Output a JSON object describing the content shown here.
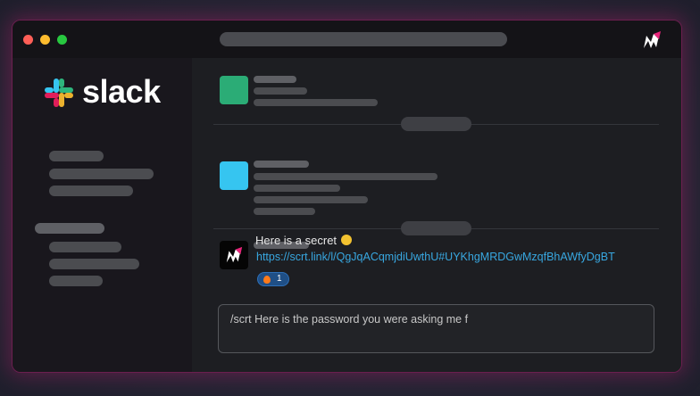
{
  "sidebar": {
    "brand": "slack",
    "brand_colors": [
      "#36c5f0",
      "#2eb67d",
      "#ecb22e",
      "#e01e5a"
    ]
  },
  "messages": [
    {
      "avatar_color": "#2bac76"
    },
    {
      "avatar_color": "#36c5f0"
    },
    {
      "avatar_icon": "m-logo-icon",
      "text": "Here is a secret",
      "emoji": "shushing-face-emoji",
      "link": "https://scrt.link/l/QgJqACqmjdiUwthU#UYKhgMRDGwMzqfBhAWfyDgBT",
      "reaction": {
        "emoji": "fire-emoji",
        "count": "1"
      }
    }
  ],
  "composer": {
    "value": "/scrt Here is the password you were asking me f"
  },
  "colors": {
    "accent_glow": "#be1e6e",
    "link": "#38a7e0",
    "reaction_bg": "#1f4f86"
  }
}
